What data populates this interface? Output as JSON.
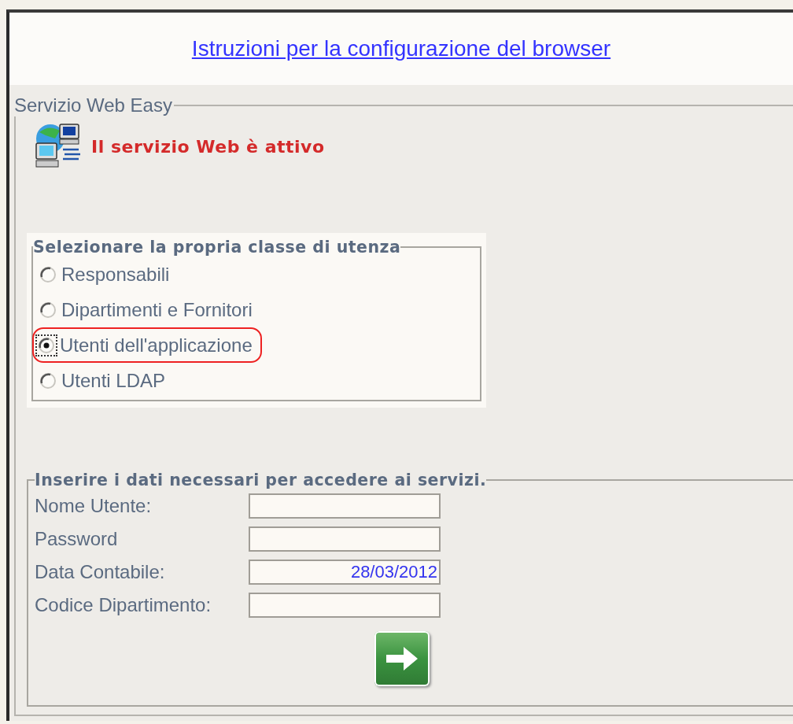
{
  "header": {
    "link": "Istruzioni per la configurazione del browser"
  },
  "service": {
    "legend": "Servizio Web Easy",
    "status": "Il servizio Web è attivo"
  },
  "user_class": {
    "legend": "Selezionare la propria classe di utenza",
    "options": [
      {
        "label": "Responsabili",
        "selected": false
      },
      {
        "label": "Dipartimenti e Fornitori",
        "selected": false
      },
      {
        "label": "Utenti dell'applicazione",
        "selected": true
      },
      {
        "label": "Utenti LDAP",
        "selected": false
      }
    ]
  },
  "login": {
    "legend": "Inserire i dati necessari per accedere ai servizi.",
    "fields": [
      {
        "label": "Nome Utente:"
      },
      {
        "label": "Password"
      },
      {
        "label": "Data Contabile:",
        "value": "28/03/2012"
      },
      {
        "label": "Codice Dipartimento:"
      }
    ]
  }
}
